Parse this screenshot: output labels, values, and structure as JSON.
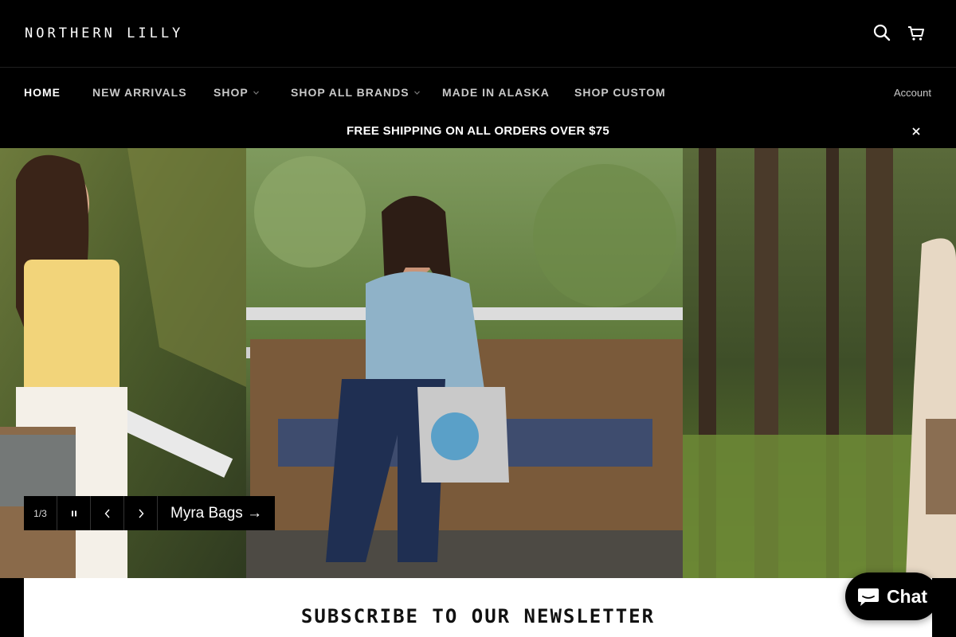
{
  "brand": {
    "name": "NORTHERN LILLY"
  },
  "header": {
    "search_icon": "search-icon",
    "cart_icon": "cart-icon"
  },
  "nav": {
    "items": [
      {
        "label": "HOME",
        "active": true,
        "has_dropdown": false
      },
      {
        "label": "NEW ARRIVALS",
        "active": false,
        "has_dropdown": false
      },
      {
        "label": "SHOP",
        "active": false,
        "has_dropdown": true
      },
      {
        "label": "SHOP ALL BRANDS",
        "active": false,
        "has_dropdown": true
      },
      {
        "label": "MADE IN ALASKA",
        "active": false,
        "has_dropdown": false
      },
      {
        "label": "SHOP CUSTOM",
        "active": false,
        "has_dropdown": false
      }
    ],
    "account_label": "Account"
  },
  "announcement": {
    "text": "FREE SHIPPING ON ALL ORDERS OVER $75",
    "close_icon": "close-icon"
  },
  "slideshow": {
    "counter": "1/3",
    "pause_icon": "pause-icon",
    "prev_icon": "chevron-left-icon",
    "next_icon": "chevron-right-icon",
    "link_label": "Myra Bags →"
  },
  "newsletter": {
    "title": "SUBSCRIBE TO OUR NEWSLETTER"
  },
  "chat": {
    "label": "Chat",
    "icon": "chat-bubble-icon"
  },
  "colors": {
    "background": "#000000",
    "text": "#ffffff",
    "nav_text": "#c9c9c9",
    "panel": "#ffffff"
  }
}
